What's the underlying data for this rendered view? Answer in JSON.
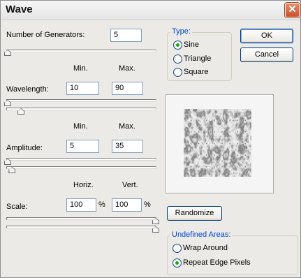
{
  "window": {
    "title": "Wave"
  },
  "buttons": {
    "ok": "OK",
    "cancel": "Cancel",
    "randomize": "Randomize"
  },
  "generators": {
    "label": "Number of Generators:",
    "value": "5",
    "fraction": 0.0
  },
  "headers": {
    "min": "Min.",
    "max": "Max.",
    "horiz": "Horiz.",
    "vert": "Vert.",
    "percent": "%"
  },
  "wavelength": {
    "label": "Wavelength:",
    "min": "10",
    "max": "90",
    "min_fraction": 0.0,
    "max_fraction": 0.09
  },
  "amplitude": {
    "label": "Amplitude:",
    "min": "5",
    "max": "35",
    "min_fraction": 0.0,
    "max_fraction": 0.03
  },
  "scale": {
    "label": "Scale:",
    "horiz": "100",
    "vert": "100",
    "horiz_fraction": 1.0,
    "vert_fraction": 1.0
  },
  "type": {
    "legend": "Type:",
    "options": [
      "Sine",
      "Triangle",
      "Square"
    ],
    "selected": "Sine"
  },
  "undefined_areas": {
    "legend": "Undefined Areas:",
    "options": [
      "Wrap Around",
      "Repeat Edge Pixels"
    ],
    "selected": "Repeat Edge Pixels"
  },
  "colors": {
    "accent": "#0046d5",
    "radio_dot": "#21a121",
    "close": "#c9502e"
  }
}
